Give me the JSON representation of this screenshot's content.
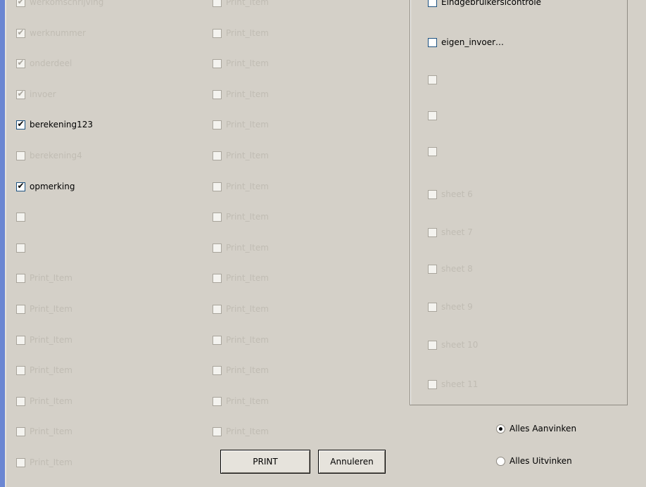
{
  "column1": [
    {
      "label": "werkomschrijving",
      "checked": true,
      "enabled": false
    },
    {
      "label": "werknummer",
      "checked": true,
      "enabled": false
    },
    {
      "label": "onderdeel",
      "checked": true,
      "enabled": false
    },
    {
      "label": "invoer",
      "checked": true,
      "enabled": false
    },
    {
      "label": "berekening123",
      "checked": true,
      "enabled": true
    },
    {
      "label": "berekening4",
      "checked": false,
      "enabled": false
    },
    {
      "label": "opmerking",
      "checked": true,
      "enabled": true
    },
    {
      "label": "",
      "checked": false,
      "enabled": false
    },
    {
      "label": "",
      "checked": false,
      "enabled": false
    },
    {
      "label": "Print_Item",
      "checked": false,
      "enabled": false
    },
    {
      "label": "Print_Item",
      "checked": false,
      "enabled": false
    },
    {
      "label": "Print_Item",
      "checked": false,
      "enabled": false
    },
    {
      "label": "Print_Item",
      "checked": false,
      "enabled": false
    },
    {
      "label": "Print_Item",
      "checked": false,
      "enabled": false
    },
    {
      "label": "Print_Item",
      "checked": false,
      "enabled": false
    },
    {
      "label": "Print_Item",
      "checked": false,
      "enabled": false
    }
  ],
  "column2": [
    {
      "label": "Print_Item",
      "checked": false,
      "enabled": false
    },
    {
      "label": "Print_Item",
      "checked": false,
      "enabled": false
    },
    {
      "label": "Print_Item",
      "checked": false,
      "enabled": false
    },
    {
      "label": "Print_Item",
      "checked": false,
      "enabled": false
    },
    {
      "label": "Print_Item",
      "checked": false,
      "enabled": false
    },
    {
      "label": "Print_Item",
      "checked": false,
      "enabled": false
    },
    {
      "label": "Print_Item",
      "checked": false,
      "enabled": false
    },
    {
      "label": "Print_Item",
      "checked": false,
      "enabled": false
    },
    {
      "label": "Print_Item",
      "checked": false,
      "enabled": false
    },
    {
      "label": "Print_Item",
      "checked": false,
      "enabled": false
    },
    {
      "label": "Print_Item",
      "checked": false,
      "enabled": false
    },
    {
      "label": "Print_Item",
      "checked": false,
      "enabled": false
    },
    {
      "label": "Print_Item",
      "checked": false,
      "enabled": false
    },
    {
      "label": "Print_Item",
      "checked": false,
      "enabled": false
    },
    {
      "label": "Print_Item",
      "checked": false,
      "enabled": false
    }
  ],
  "sheets": [
    {
      "label": "Eindgebruikersicontrole",
      "checked": false,
      "enabled": true
    },
    {
      "label": "eigen_invoer…",
      "checked": false,
      "enabled": true
    },
    {
      "label": "",
      "checked": false,
      "enabled": false
    },
    {
      "label": "",
      "checked": false,
      "enabled": false
    },
    {
      "label": "",
      "checked": false,
      "enabled": false
    },
    {
      "label": "sheet 6",
      "checked": false,
      "enabled": false
    },
    {
      "label": "sheet 7",
      "checked": false,
      "enabled": false
    },
    {
      "label": "sheet 8",
      "checked": false,
      "enabled": false
    },
    {
      "label": "sheet 9",
      "checked": false,
      "enabled": false
    },
    {
      "label": "sheet 10",
      "checked": false,
      "enabled": false
    },
    {
      "label": "sheet 11",
      "checked": false,
      "enabled": false
    }
  ],
  "buttons": {
    "print": "PRINT",
    "cancel": "Annuleren"
  },
  "radios": [
    {
      "label": "Alles Aanvinken",
      "selected": true
    },
    {
      "label": "Alles Uitvinken",
      "selected": false
    }
  ]
}
